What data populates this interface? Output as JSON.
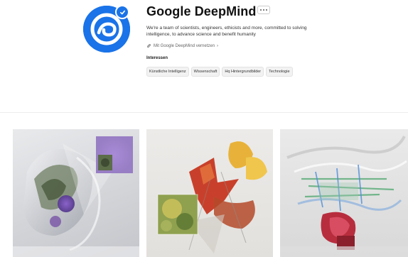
{
  "profile": {
    "name": "Google DeepMind",
    "bio": "We're a team of scientists, engineers, ethicists and more, committed to solving intelligence, to advance science and benefit humanity",
    "connect_label": "Mit Google DeepMind vernetzen",
    "interests_title": "Interessen",
    "tags": [
      "Künstliche Intelligenz",
      "Wissenschaft",
      "Hq Hintergrundbilder",
      "Technologie"
    ]
  },
  "colors": {
    "brand": "#1a73e8"
  },
  "icons": {
    "avatar": "deepmind-logo-icon",
    "verified": "verified-check-icon",
    "more": "more-horizontal-icon",
    "link": "link-icon"
  }
}
